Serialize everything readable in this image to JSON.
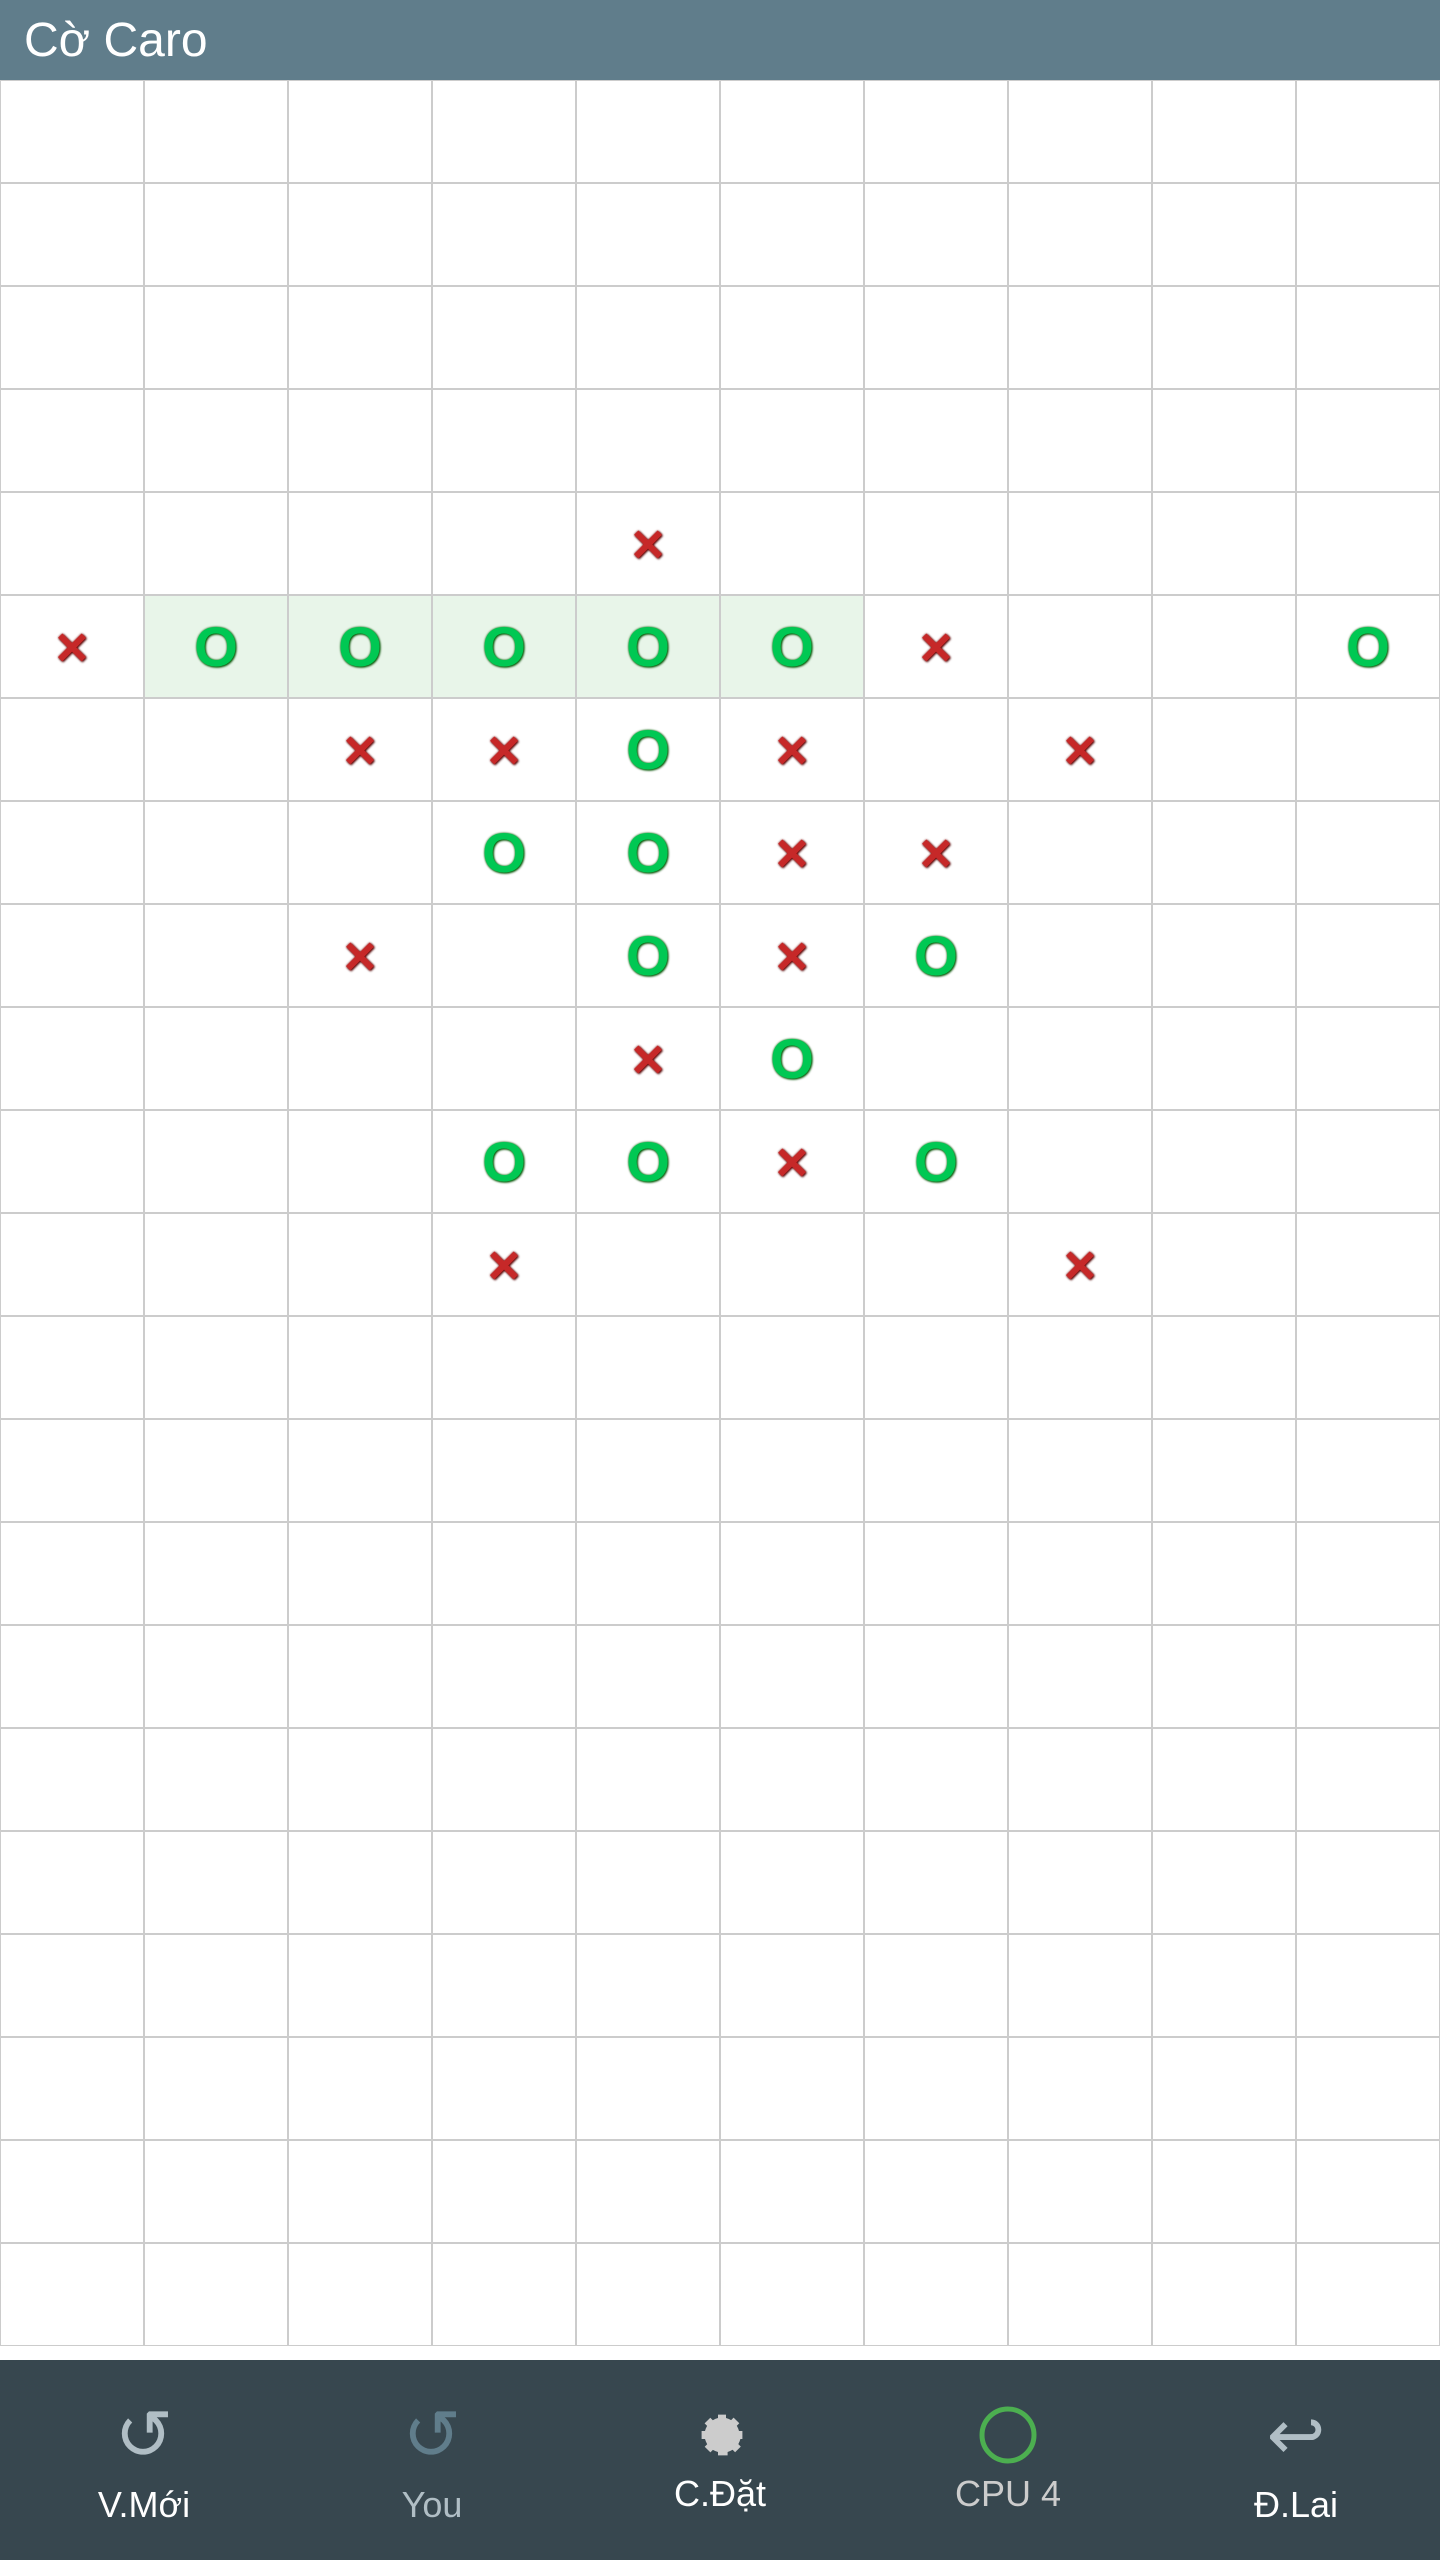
{
  "header": {
    "title": "Cờ Caro"
  },
  "board": {
    "cols": 10,
    "rows": 22,
    "cellSize": 144,
    "pieces": [
      {
        "row": 4,
        "col": 4,
        "type": "X"
      },
      {
        "row": 5,
        "col": 0,
        "type": "X"
      },
      {
        "row": 5,
        "col": 1,
        "type": "O",
        "highlight": true
      },
      {
        "row": 5,
        "col": 2,
        "type": "O",
        "highlight": true
      },
      {
        "row": 5,
        "col": 3,
        "type": "O",
        "highlight": true
      },
      {
        "row": 5,
        "col": 4,
        "type": "O",
        "highlight": true
      },
      {
        "row": 5,
        "col": 5,
        "type": "O",
        "highlight": true
      },
      {
        "row": 5,
        "col": 6,
        "type": "X"
      },
      {
        "row": 5,
        "col": 9,
        "type": "O"
      },
      {
        "row": 6,
        "col": 2,
        "type": "X"
      },
      {
        "row": 6,
        "col": 3,
        "type": "X"
      },
      {
        "row": 6,
        "col": 4,
        "type": "O"
      },
      {
        "row": 6,
        "col": 5,
        "type": "X"
      },
      {
        "row": 6,
        "col": 7,
        "type": "X"
      },
      {
        "row": 7,
        "col": 3,
        "type": "O"
      },
      {
        "row": 7,
        "col": 4,
        "type": "O"
      },
      {
        "row": 7,
        "col": 5,
        "type": "X"
      },
      {
        "row": 7,
        "col": 6,
        "type": "X"
      },
      {
        "row": 8,
        "col": 2,
        "type": "X"
      },
      {
        "row": 8,
        "col": 4,
        "type": "O"
      },
      {
        "row": 8,
        "col": 5,
        "type": "X"
      },
      {
        "row": 8,
        "col": 6,
        "type": "O"
      },
      {
        "row": 9,
        "col": 4,
        "type": "X"
      },
      {
        "row": 9,
        "col": 5,
        "type": "O"
      },
      {
        "row": 10,
        "col": 3,
        "type": "O"
      },
      {
        "row": 10,
        "col": 4,
        "type": "O"
      },
      {
        "row": 10,
        "col": 5,
        "type": "X"
      },
      {
        "row": 10,
        "col": 6,
        "type": "O"
      },
      {
        "row": 11,
        "col": 3,
        "type": "X"
      },
      {
        "row": 11,
        "col": 7,
        "type": "X"
      }
    ],
    "highlightRow": 5,
    "highlightCols": [
      1,
      2,
      3,
      4,
      5
    ]
  },
  "footer": {
    "buttons": [
      {
        "id": "new",
        "label": "V.Mới",
        "icon": "↺",
        "active": true
      },
      {
        "id": "you",
        "label": "You",
        "icon": "↺",
        "active": false,
        "disabled": true
      },
      {
        "id": "settings",
        "label": "C.Đặt",
        "icon": "gear",
        "active": true
      },
      {
        "id": "cpu",
        "label": "CPU 4",
        "icon": "circle",
        "active": false,
        "green": true
      },
      {
        "id": "undo",
        "label": "Đ.Lai",
        "icon": "↩",
        "active": true
      }
    ]
  }
}
